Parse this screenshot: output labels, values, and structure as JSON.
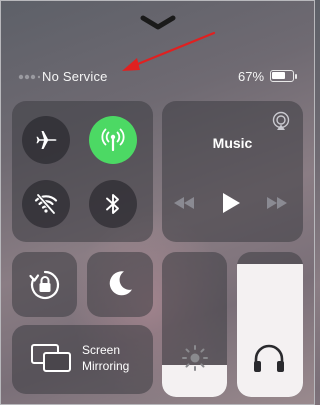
{
  "status_bar": {
    "carrier": "No Service",
    "battery_percent_text": "67%",
    "battery_level": 0.67
  },
  "control_center": {
    "connectivity": {
      "airplane_mode": {
        "icon": "airplane-icon",
        "active": false
      },
      "cellular_data": {
        "icon": "antenna-icon",
        "active": true,
        "color": "#4cd964"
      },
      "wifi": {
        "icon": "wifi-off-icon",
        "active": false
      },
      "bluetooth": {
        "icon": "bluetooth-icon",
        "active": false
      }
    },
    "music": {
      "title": "Music",
      "controls": [
        "rewind-icon",
        "play-icon",
        "fast-forward-icon"
      ],
      "airplay_icon": "airplay-icon"
    },
    "orientation_lock": {
      "icon": "rotation-lock-icon",
      "active": false
    },
    "do_not_disturb": {
      "icon": "moon-icon",
      "active": false
    },
    "screen_mirroring": {
      "label_line1": "Screen",
      "label_line2": "Mirroring",
      "icon": "screen-mirroring-icon"
    },
    "brightness": {
      "level": 0.22,
      "icon": "sun-icon"
    },
    "volume": {
      "level": 0.92,
      "icon": "headphones-icon"
    }
  },
  "annotation": {
    "arrow_color": "#e02020"
  }
}
